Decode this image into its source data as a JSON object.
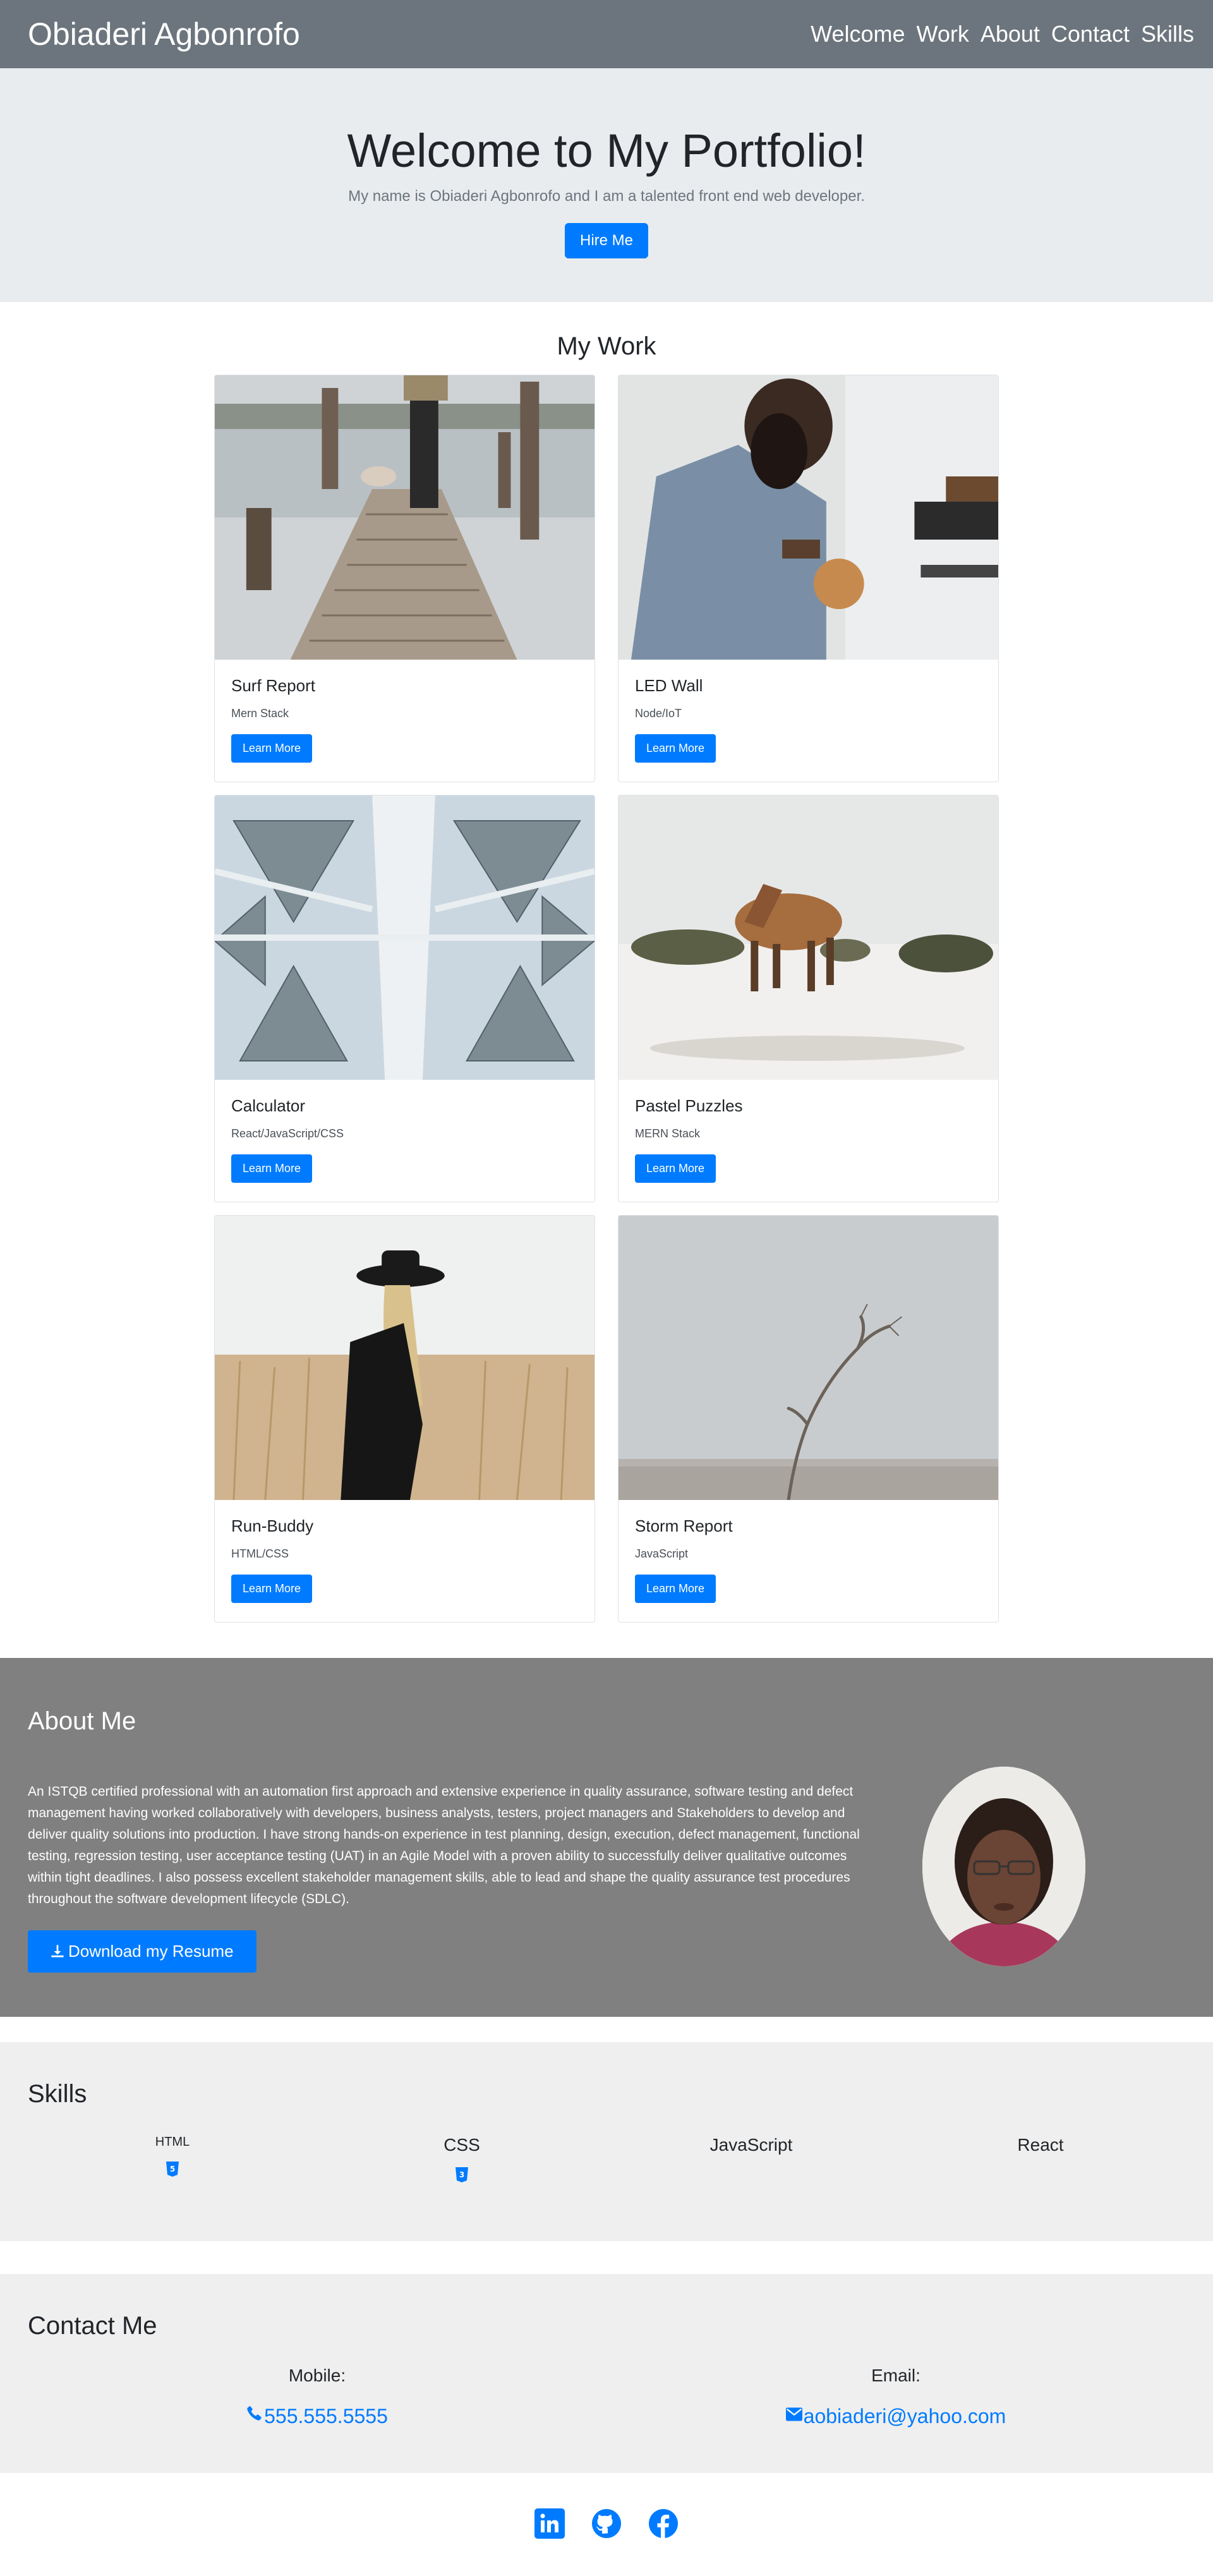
{
  "nav": {
    "brand": "Obiaderi Agbonrofo",
    "links": [
      "Welcome",
      "Work",
      "About",
      "Contact",
      "Skills"
    ]
  },
  "hero": {
    "title": "Welcome to My Portfolio!",
    "subtitle": "My name is Obiaderi Agbonrofo and I am a talented front end web developer.",
    "button": "Hire Me"
  },
  "work": {
    "heading": "My Work",
    "cards": [
      {
        "title": "Surf Report",
        "stack": "Mern Stack",
        "button": "Learn More",
        "image": "pier-dog-photo"
      },
      {
        "title": "LED Wall",
        "stack": "Node/IoT",
        "button": "Learn More",
        "image": "barista-photo"
      },
      {
        "title": "Calculator",
        "stack": "React/JavaScript/CSS",
        "button": "Learn More",
        "image": "fractal-structure-photo"
      },
      {
        "title": "Pastel Puzzles",
        "stack": "MERN Stack",
        "button": "Learn More",
        "image": "horse-snow-photo"
      },
      {
        "title": "Run-Buddy",
        "stack": "HTML/CSS",
        "button": "Learn More",
        "image": "woman-hat-field-photo"
      },
      {
        "title": "Storm Report",
        "stack": "JavaScript",
        "button": "Learn More",
        "image": "bare-tree-photo"
      }
    ]
  },
  "about": {
    "heading": "About Me",
    "text": "An ISTQB certified professional with an automation first approach and extensive experience in quality assurance, software testing and defect management having worked collaboratively with developers, business analysts, testers, project managers and Stakeholders to develop and deliver quality solutions into production. I have strong hands-on experience in test planning, design, execution, defect management, functional testing, regression testing, user acceptance testing (UAT) in an Agile Model with a proven ability to successfully deliver qualitative outcomes within tight deadlines. I also possess excellent stakeholder management skills, able to lead and shape the quality assurance test procedures throughout the software development lifecycle (SDLC).",
    "button": "Download my Resume"
  },
  "skills": {
    "heading": "Skills",
    "items": [
      {
        "name": "HTML",
        "icon": "html5-icon"
      },
      {
        "name": "CSS",
        "icon": "css3-icon"
      },
      {
        "name": "JavaScript",
        "icon": ""
      },
      {
        "name": "React",
        "icon": ""
      }
    ]
  },
  "contact": {
    "heading": "Contact Me",
    "mobile_label": "Mobile:",
    "mobile_value": "555.555.5555",
    "email_label": "Email:",
    "email_value": "aobiaderi@yahoo.com"
  },
  "footer": {
    "icons": [
      "linkedin-icon",
      "github-icon",
      "facebook-icon"
    ]
  },
  "colors": {
    "navbar": "#6c757d",
    "hero_bg": "#e9ecef",
    "accent": "#007bff",
    "about_bg": "#808080",
    "section_bg": "#efefef"
  }
}
